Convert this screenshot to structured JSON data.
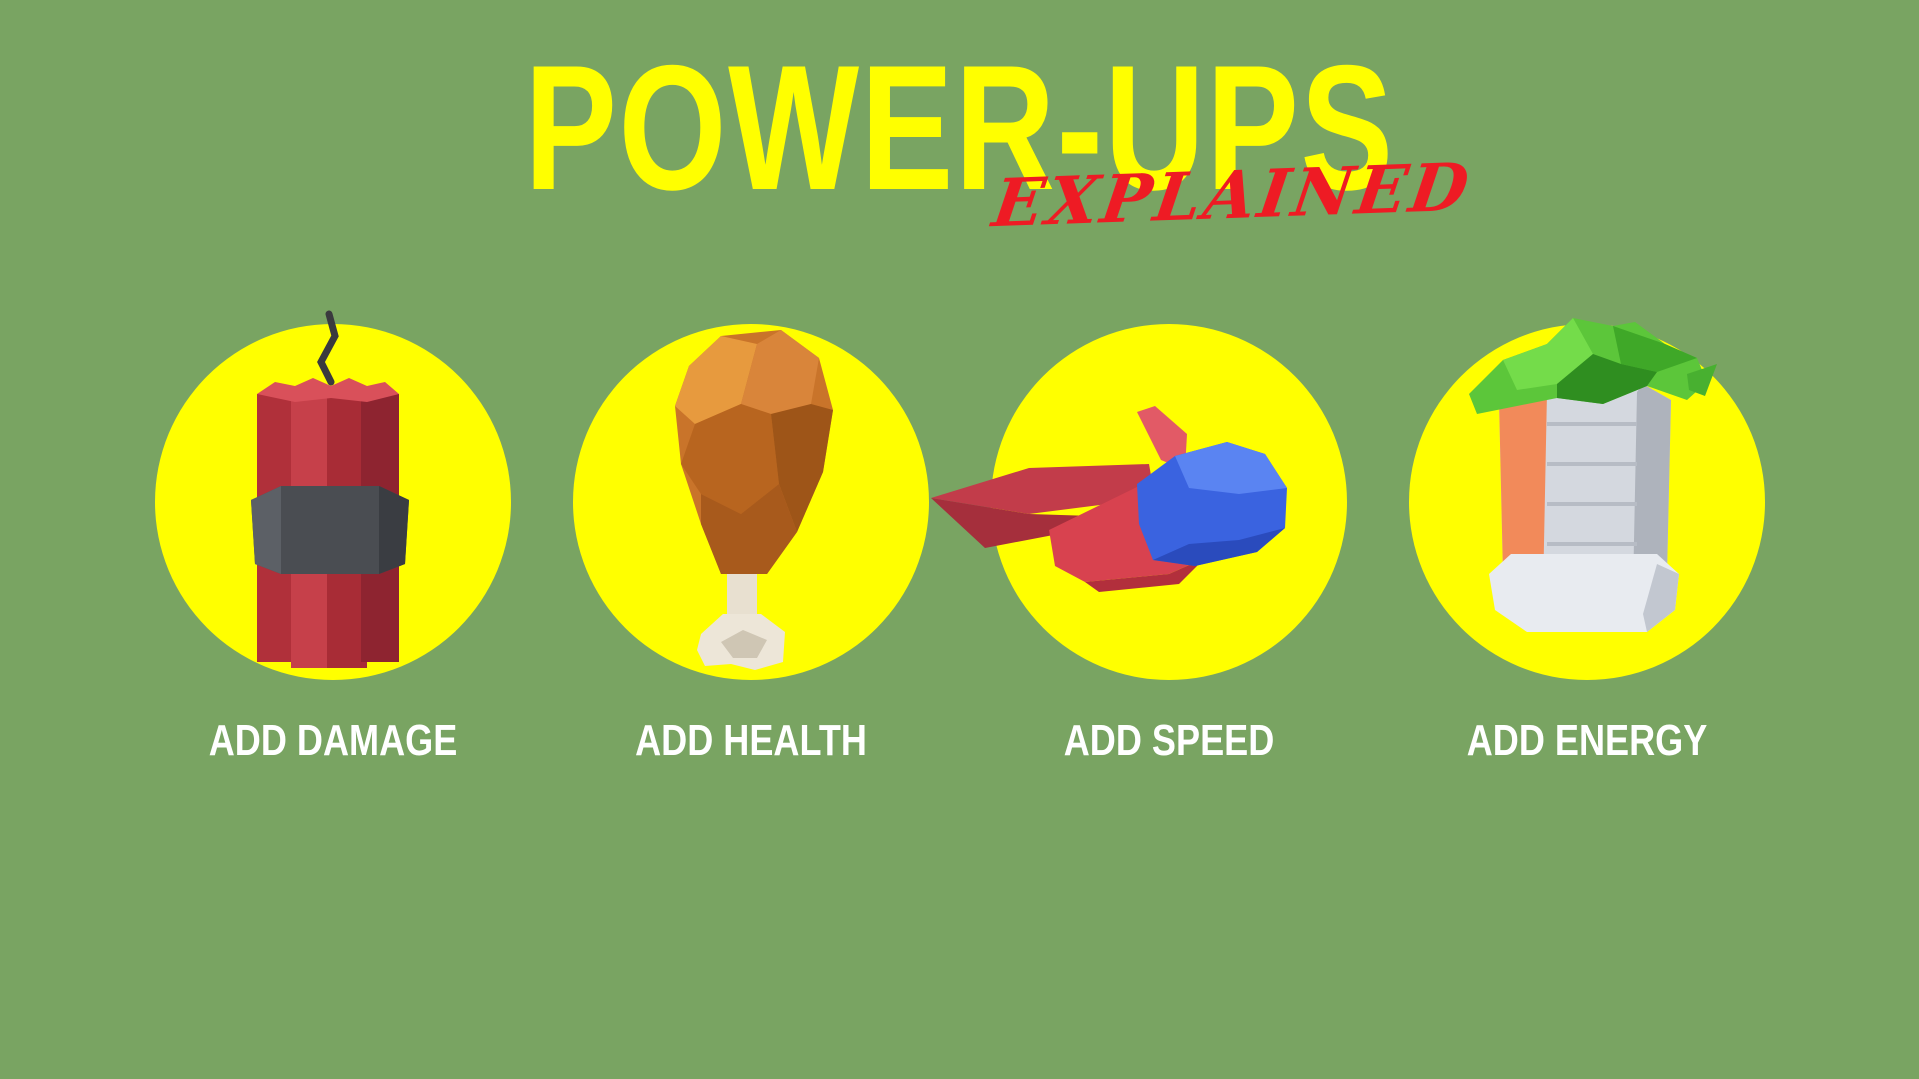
{
  "title": "POWER-UPS",
  "subtitle": "EXPLAINED",
  "colors": {
    "background": "#79a462",
    "title": "#ffff00",
    "subtitle": "#ee1b24",
    "circle": "#ffff00",
    "label": "#ffffff"
  },
  "powerups": [
    {
      "label": "ADD DAMAGE",
      "icon": "dynamite-icon"
    },
    {
      "label": "ADD HEALTH",
      "icon": "chicken-leg-icon"
    },
    {
      "label": "ADD SPEED",
      "icon": "rocket-icon"
    },
    {
      "label": "ADD ENERGY",
      "icon": "energy-can-icon"
    }
  ]
}
